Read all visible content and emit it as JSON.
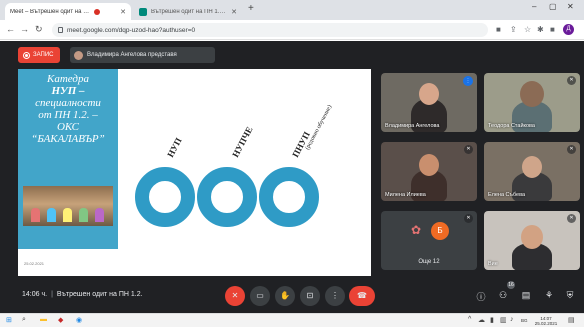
{
  "browser": {
    "tabs": [
      {
        "title": "Meet – Вътрешен одит на ПН 1.2",
        "active": true,
        "recording": true
      },
      {
        "title": "Вътрешен одит на ПН 1.2 – Google Docs",
        "active": false
      }
    ],
    "new_tab": "+",
    "url": "meet.google.com/dqp-uzod-hao?authuser=0",
    "profile_initial": "Д"
  },
  "meet": {
    "record_label": "ЗАПИС",
    "presenter_label": "Владимира Ангелова представя",
    "slide": {
      "heading_lines": [
        "Катедра",
        "НУП –",
        "специалности",
        "от ПН 1.2. –",
        "ОКС",
        "“БАКАЛАВЪР”"
      ],
      "labels": [
        "НУП",
        "НУПЧЕ",
        "ПНУП"
      ],
      "sublabel": "(редовно обучение)",
      "footer": "25.02.2021"
    },
    "participants": [
      {
        "name": "Владимира Ангелова",
        "speaking": true
      },
      {
        "name": "Теодора Стайкова",
        "muted": true
      },
      {
        "name": "Милена Илиева",
        "muted": true
      },
      {
        "name": "Елена Събева",
        "muted": true
      },
      {
        "name": "Още 12",
        "avatar": "Б",
        "muted": true
      },
      {
        "name": "Вие",
        "muted": true
      }
    ],
    "time": "14:06 ч.",
    "meeting_title": "Вътрешен одит на ПН 1.2.",
    "participants_count": "16",
    "accent": "#ea4335",
    "ring_color": "#2f9bc6",
    "slide_panel_color": "#42a5c9"
  },
  "taskbar": {
    "lang": "BG",
    "time": "14:07",
    "date": "25.02.2021"
  }
}
